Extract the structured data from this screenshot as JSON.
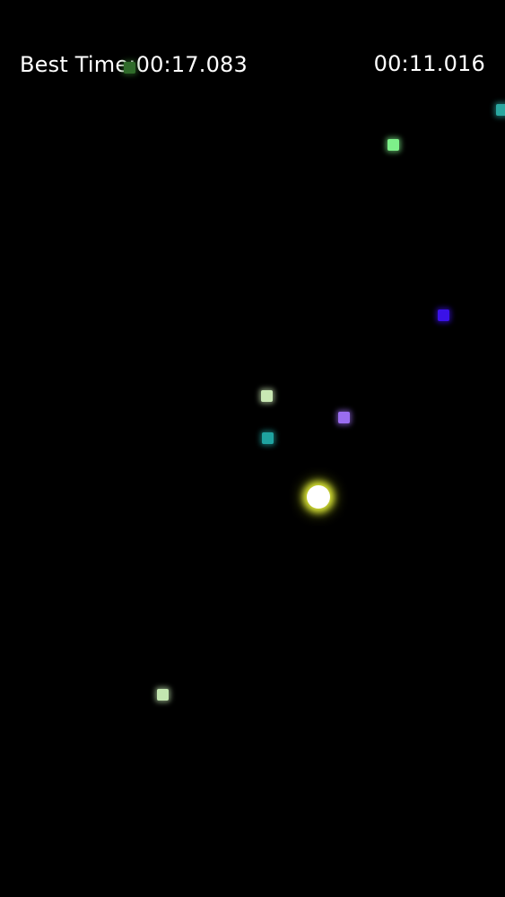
{
  "hud": {
    "best_time_label": "Best Time:",
    "best_time_value": "00:17.083",
    "current_time": "00:11.016"
  },
  "player": {
    "color": "#ffffff",
    "glow_color": "#e6f03c"
  },
  "particles": [
    {
      "color": "#2f6b2a"
    },
    {
      "color": "#2aa7a0"
    },
    {
      "color": "#7ef08a"
    },
    {
      "color": "#3a12e8"
    },
    {
      "color": "#c9e8b4"
    },
    {
      "color": "#9a6df0"
    },
    {
      "color": "#1fa3a0"
    },
    {
      "color": "#c3e6b0"
    }
  ]
}
